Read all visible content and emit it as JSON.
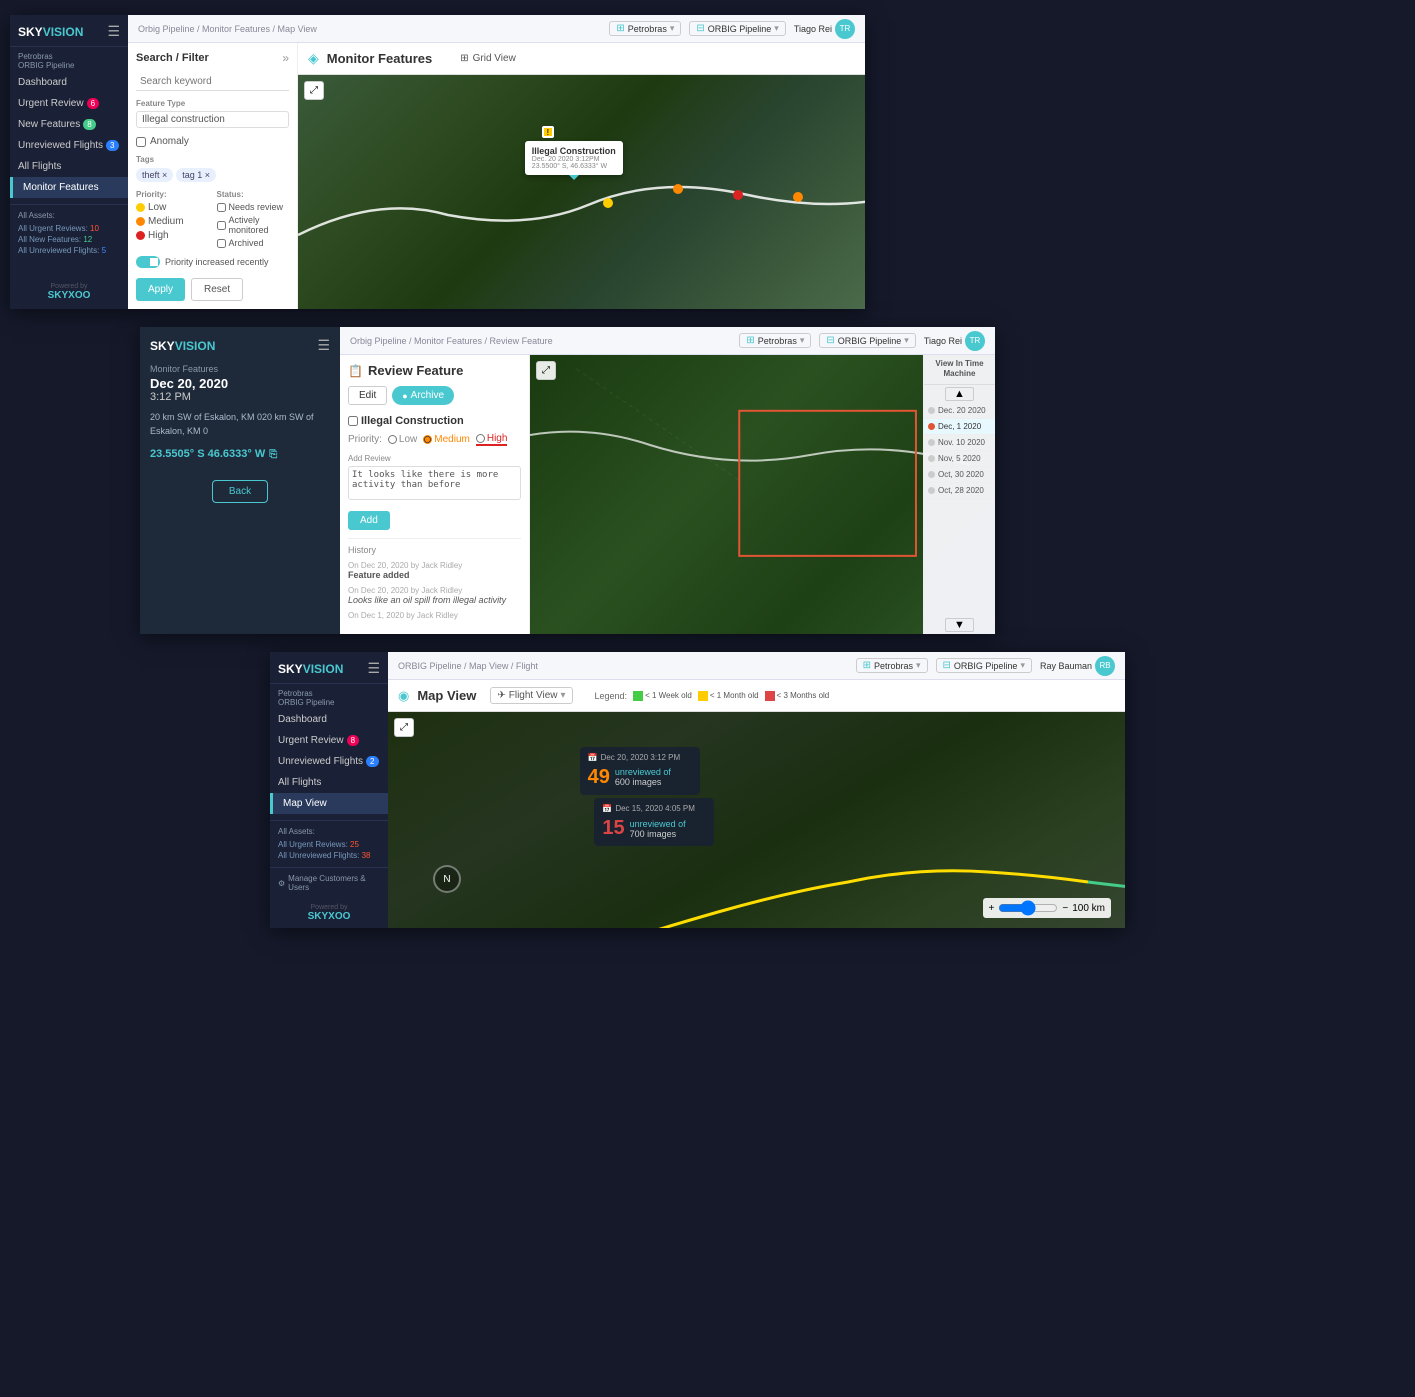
{
  "app": {
    "name": "SKY",
    "name_accent": "VISION",
    "powered_by": "Powered by",
    "skyxoo": "SKYXOO"
  },
  "screen1": {
    "topbar": {
      "breadcrumb": "Orbig Pipeline / Monitor Features / Map View",
      "client": "Petrobras",
      "pipeline": "ORBIG Pipeline",
      "user": "Tiago Rei"
    },
    "header": "Monitor Features",
    "grid_view": "Grid View",
    "sidebar": {
      "client": "Petrobras",
      "pipeline": "ORBIG Pipeline",
      "nav": [
        "Dashboard",
        "Urgent Review",
        "New Features",
        "Unreviewed Flights",
        "All Flights",
        "Monitor Features"
      ],
      "urgent_badge": "6",
      "new_features_badge": "8",
      "unreviewed_badge": "3",
      "assets_title": "All Assets:",
      "assets": [
        {
          "label": "All Urgent Reviews:",
          "value": "10"
        },
        {
          "label": "All New Features:",
          "value": "12"
        },
        {
          "label": "All Unreviewed Flights:",
          "value": "5"
        }
      ]
    },
    "filter": {
      "title": "Search / Filter",
      "search_placeholder": "Search keyword",
      "feature_type_label": "Feature Type",
      "feature_type_value": "Illegal construction",
      "anomaly_label": "Anomaly",
      "tags_label": "Tags",
      "tags": [
        "theft",
        "tag 1"
      ],
      "priority_label": "Priority:",
      "priority": [
        "Low",
        "Medium",
        "High"
      ],
      "status_label": "Status:",
      "status": [
        "Needs review",
        "Actively monitored",
        "Archived"
      ],
      "toggle_label": "Priority increased recently",
      "apply": "Apply",
      "reset": "Reset"
    },
    "map": {
      "popup_title": "Illegal Construction",
      "popup_date": "Dec. 20 2020 3:12PM",
      "popup_coords": "23.5500° S, 46.6333° W"
    }
  },
  "screen2": {
    "topbar": {
      "breadcrumb": "Orbig Pipeline / Monitor Features / Review Feature",
      "client": "Petrobras",
      "pipeline": "ORBIG Pipeline",
      "user": "Tiago Rei"
    },
    "left": {
      "section": "Monitor Features",
      "date": "Dec 20, 2020",
      "time": "3:12 PM",
      "description": "20 km SW of Eskalon, KM 020 km SW of Eskalon, KM 0",
      "coords": "23.5505° S 46.6333° W",
      "back": "Back"
    },
    "right": {
      "title": "Review Feature",
      "edit": "Edit",
      "archive": "Archive",
      "feature_title": "Illegal Construction",
      "priority_label": "Priority:",
      "priority": {
        "low": "Low",
        "medium": "Medium",
        "high": "High"
      },
      "add_review_label": "Add Review",
      "review_text": "It looks like there is more activity than before",
      "add_btn": "Add",
      "history_label": "History",
      "history": [
        {
          "meta": "On Dec 20, 2020 by Jack Ridley",
          "text": "Feature added",
          "bold": true
        },
        {
          "meta": "On Dec 20, 2020 by Jack Ridley",
          "text": "Looks like an oil spill from illegal activity",
          "bold": false
        },
        {
          "meta": "On Dec 1, 2020 by Jack Ridley",
          "text": "",
          "bold": false
        }
      ],
      "timemachine": {
        "title": "View In Time Machine",
        "nav_up": "▲",
        "nav_down": "▼",
        "items": [
          {
            "date": "Dec. 20 2020",
            "active": false
          },
          {
            "date": "Dec, 1 2020",
            "active": true
          },
          {
            "date": "Nov. 10 2020",
            "active": false
          },
          {
            "date": "Nov, 5 2020",
            "active": false
          },
          {
            "date": "Oct, 30 2020",
            "active": false
          },
          {
            "date": "Oct, 28 2020",
            "active": false
          }
        ]
      }
    }
  },
  "screen3": {
    "topbar": {
      "breadcrumb": "ORBIG Pipeline / Map View / Flight",
      "client": "Petrobras",
      "pipeline": "ORBIG Pipeline",
      "user": "Ray Bauman"
    },
    "sidebar": {
      "client": "Petrobras",
      "pipeline": "ORBIG Pipeline",
      "nav": [
        "Dashboard",
        "Urgent Review",
        "Unreviewed Flights",
        "All Flights",
        "Map View"
      ],
      "urgent_badge": "8",
      "unreviewed_badge": "2",
      "assets_title": "All Assets:",
      "assets": [
        {
          "label": "All Urgent Reviews:",
          "value": "25"
        },
        {
          "label": "All Unreviewed Flights:",
          "value": "38"
        }
      ],
      "manage": "Manage Customers & Users"
    },
    "header": "Map View",
    "flight_view": "Flight View",
    "legend": {
      "label": "Legend:",
      "items": [
        "< 1 Week old",
        "< 1 Month old",
        "< 3 Months old"
      ]
    },
    "popups": [
      {
        "date": "Dec 20, 2020  3:12 PM",
        "num": "49",
        "text1": "unreviewed of",
        "text2": "600  images"
      },
      {
        "date": "Dec 15, 2020  4:05 PM",
        "num": "15",
        "text1": "unreviewed of",
        "text2": "700  images"
      }
    ],
    "zoom_minus": "−",
    "zoom_plus": "+",
    "zoom_range": "100 km"
  }
}
